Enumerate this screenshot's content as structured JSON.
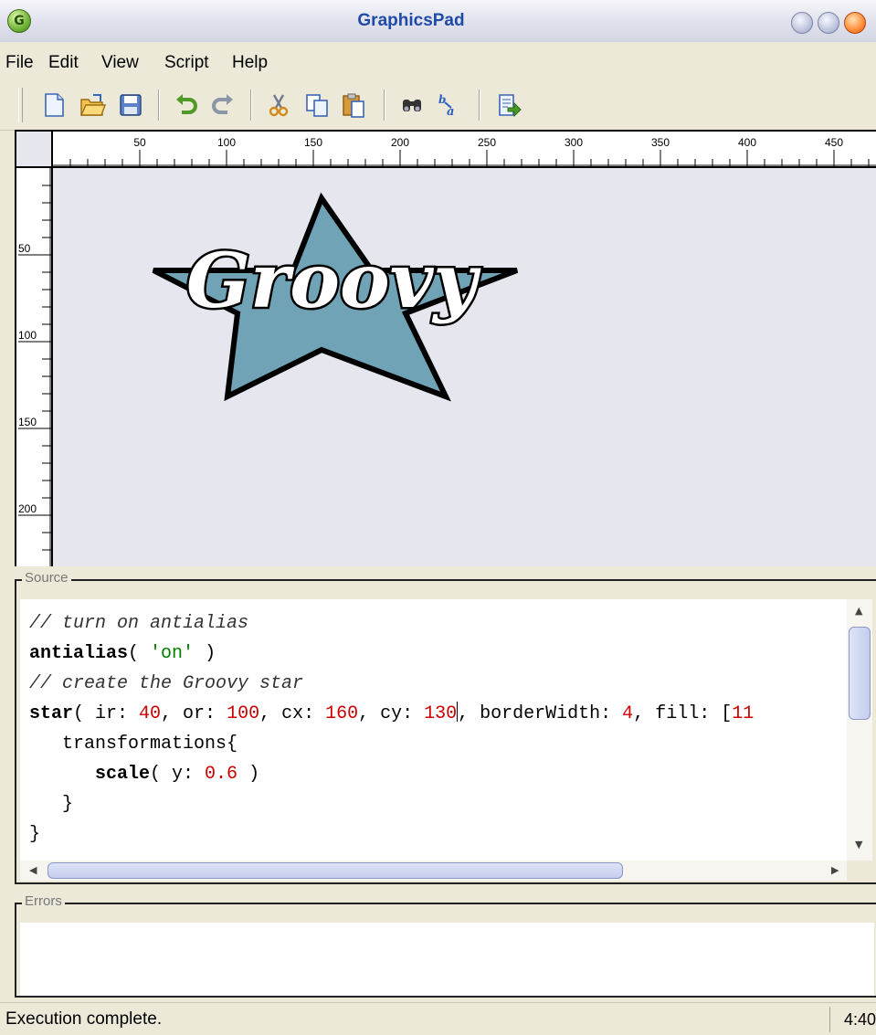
{
  "window": {
    "title": "GraphicsPad",
    "app_icon_letter": "G"
  },
  "menu": [
    "File",
    "Edit",
    "View",
    "Script",
    "Help"
  ],
  "toolbar": {
    "buttons": [
      "new-file-icon",
      "open-folder-icon",
      "save-icon",
      "undo-icon",
      "redo-icon",
      "cut-icon",
      "copy-icon",
      "paste-icon",
      "find-icon",
      "replace-icon",
      "run-script-icon"
    ]
  },
  "rulers": {
    "horizontal_labels": [
      "50",
      "100",
      "150",
      "200",
      "250",
      "300",
      "350",
      "400",
      "450"
    ],
    "vertical_labels": [
      "50",
      "100",
      "150",
      "200"
    ]
  },
  "canvas": {
    "text": "Groovy",
    "star_fill": "#6FA3B5",
    "border_color": "#000000",
    "background": "#E6E6EE"
  },
  "source": {
    "title": "Source",
    "lines": [
      "// turn on antialias",
      "antialias( 'on' )",
      "// create the Groovy star",
      "star( ir: 40, or: 100, cx: 160, cy: 130, borderWidth: 4, fill: [11",
      "   transformations{",
      "      scale( y: 0.6 )",
      "   }",
      "}"
    ],
    "tokens": {
      "line1": "// turn on antialias",
      "line2_kw": "antialias",
      "line2_a": "( ",
      "line2_str": "'on'",
      "line2_b": " )",
      "line3": "// create the Groovy star",
      "line4_kw": "star",
      "line4_a": "( ir: ",
      "line4_n1": "40",
      "line4_b": ", or: ",
      "line4_n2": "100",
      "line4_c": ", cx: ",
      "line4_n3": "160",
      "line4_d": ", cy: ",
      "line4_n4": "130",
      "line4_e": ", borderWidth: ",
      "line4_n5": "4",
      "line4_f": ", fill: [",
      "line4_n6": "11",
      "line5": "   transformations{",
      "line6_indent": "      ",
      "line6_kw": "scale",
      "line6_a": "( y: ",
      "line6_n": "0.6",
      "line6_b": " )",
      "line7": "   }",
      "line8": "}"
    }
  },
  "errors": {
    "title": "Errors",
    "content": ""
  },
  "status": {
    "message": "Execution complete.",
    "position": "4:40"
  }
}
